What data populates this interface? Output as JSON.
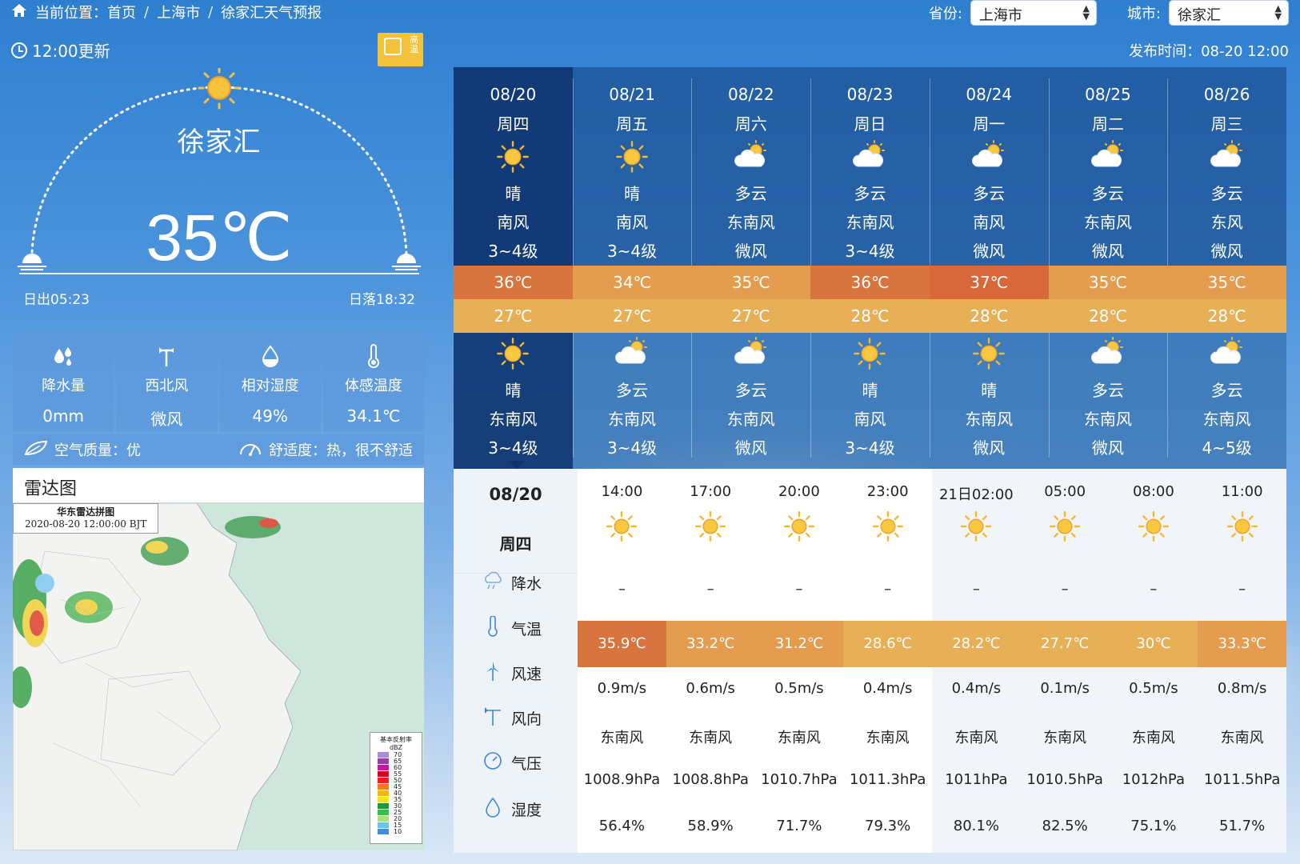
{
  "breadcrumb": {
    "label": "当前位置：",
    "home": "首页",
    "city": "上海市",
    "current": "徐家汇天气预报",
    "sep": "/"
  },
  "province": {
    "label": "省份:",
    "value": "上海市"
  },
  "city": {
    "label": "城市:",
    "value": "徐家汇"
  },
  "current": {
    "update": "12:00更新",
    "alert_badge": "高温",
    "place": "徐家汇",
    "temp": "35℃",
    "sunrise": "日出05:23",
    "sunset": "日落18:32",
    "stats": [
      {
        "icon": "raindrops-icon",
        "label": "降水量",
        "value": "0mm"
      },
      {
        "icon": "wind-vane-icon",
        "label": "西北风",
        "value": "微风"
      },
      {
        "icon": "humidity-drop-icon",
        "label": "相对湿度",
        "value": "49%"
      },
      {
        "icon": "thermometer-icon",
        "label": "体感温度",
        "value": "34.1℃"
      }
    ],
    "air_quality": "空气质量：优",
    "comfort": "舒适度：热，很不舒适"
  },
  "radar": {
    "title": "雷达图",
    "caption_title": "华东雷达拼图",
    "caption_time": "2020-08-20 12:00:00 BJT",
    "legend_title": "基本反射率",
    "legend_unit": "dBZ",
    "legend_values": [
      "70",
      "65",
      "60",
      "55",
      "50",
      "45",
      "40",
      "35",
      "30",
      "25",
      "20",
      "15",
      "10"
    ]
  },
  "publish_time": "发布时间：08-20 12:00",
  "daily": [
    {
      "date": "08/20",
      "weekday": "周四",
      "day_icon": "sun-icon",
      "day_wx": "晴",
      "day_wind": "南风",
      "day_level": "3~4级",
      "high": "36℃",
      "low": "27℃",
      "night_icon": "sun-icon",
      "night_wx": "晴",
      "night_wind": "东南风",
      "night_level": "3~4级",
      "high_color": "#d8743d",
      "low_color": "#e8b056"
    },
    {
      "date": "08/21",
      "weekday": "周五",
      "day_icon": "sun-icon",
      "day_wx": "晴",
      "day_wind": "南风",
      "day_level": "3~4级",
      "high": "34℃",
      "low": "27℃",
      "night_icon": "cloud-sun-icon",
      "night_wx": "多云",
      "night_wind": "东南风",
      "night_level": "3~4级",
      "high_color": "#e49c4e",
      "low_color": "#e8b056"
    },
    {
      "date": "08/22",
      "weekday": "周六",
      "day_icon": "cloud-sun-icon",
      "day_wx": "多云",
      "day_wind": "东南风",
      "day_level": "微风",
      "high": "35℃",
      "low": "27℃",
      "night_icon": "cloud-sun-icon",
      "night_wx": "多云",
      "night_wind": "东南风",
      "night_level": "微风",
      "high_color": "#e49c4e",
      "low_color": "#e8b056"
    },
    {
      "date": "08/23",
      "weekday": "周日",
      "day_icon": "cloud-sun-icon",
      "day_wx": "多云",
      "day_wind": "东南风",
      "day_level": "3~4级",
      "high": "36℃",
      "low": "28℃",
      "night_icon": "sun-icon",
      "night_wx": "晴",
      "night_wind": "南风",
      "night_level": "3~4级",
      "high_color": "#d8743d",
      "low_color": "#e8b056"
    },
    {
      "date": "08/24",
      "weekday": "周一",
      "day_icon": "cloud-sun-icon",
      "day_wx": "多云",
      "day_wind": "南风",
      "day_level": "微风",
      "high": "37℃",
      "low": "28℃",
      "night_icon": "sun-icon",
      "night_wx": "晴",
      "night_wind": "东南风",
      "night_level": "微风",
      "high_color": "#d8673a",
      "low_color": "#e8b056"
    },
    {
      "date": "08/25",
      "weekday": "周二",
      "day_icon": "cloud-sun-icon",
      "day_wx": "多云",
      "day_wind": "东南风",
      "day_level": "微风",
      "high": "35℃",
      "low": "28℃",
      "night_icon": "cloud-sun-icon",
      "night_wx": "多云",
      "night_wind": "东南风",
      "night_level": "微风",
      "high_color": "#e49c4e",
      "low_color": "#e8b056"
    },
    {
      "date": "08/26",
      "weekday": "周三",
      "day_icon": "cloud-sun-icon",
      "day_wx": "多云",
      "day_wind": "东风",
      "day_level": "微风",
      "high": "35℃",
      "low": "28℃",
      "night_icon": "cloud-sun-icon",
      "night_wx": "多云",
      "night_wind": "东南风",
      "night_level": "4~5级",
      "high_color": "#e49c4e",
      "low_color": "#e8b056"
    }
  ],
  "hourly": {
    "date": "08/20",
    "weekday": "周四",
    "row_labels": {
      "rain": "降水",
      "temp": "气温",
      "wind_speed": "风速",
      "wind_dir": "风向",
      "pressure": "气压",
      "humidity": "湿度"
    },
    "columns": [
      {
        "time": "14:00",
        "icon": "sun-icon",
        "rain": "–",
        "temp": "35.9℃",
        "temp_color": "#d8743d",
        "wind_speed": "0.9m/s",
        "wind_dir": "东南风",
        "pressure": "1008.9hPa",
        "humidity": "56.4%"
      },
      {
        "time": "17:00",
        "icon": "sun-icon",
        "rain": "–",
        "temp": "33.2℃",
        "temp_color": "#e49c4e",
        "wind_speed": "0.6m/s",
        "wind_dir": "东南风",
        "pressure": "1008.8hPa",
        "humidity": "58.9%"
      },
      {
        "time": "20:00",
        "icon": "sun-icon",
        "rain": "–",
        "temp": "31.2℃",
        "temp_color": "#e49c4e",
        "wind_speed": "0.5m/s",
        "wind_dir": "东南风",
        "pressure": "1010.7hPa",
        "humidity": "71.7%"
      },
      {
        "time": "23:00",
        "icon": "sun-icon",
        "rain": "–",
        "temp": "28.6℃",
        "temp_color": "#e8b056",
        "wind_speed": "0.4m/s",
        "wind_dir": "东南风",
        "pressure": "1011.3hPa",
        "humidity": "79.3%"
      },
      {
        "time": "21日02:00",
        "icon": "sun-icon",
        "rain": "–",
        "temp": "28.2℃",
        "temp_color": "#e8b056",
        "wind_speed": "0.4m/s",
        "wind_dir": "东南风",
        "pressure": "1011hPa",
        "humidity": "80.1%"
      },
      {
        "time": "05:00",
        "icon": "sun-icon",
        "rain": "–",
        "temp": "27.7℃",
        "temp_color": "#e8b056",
        "wind_speed": "0.1m/s",
        "wind_dir": "东南风",
        "pressure": "1010.5hPa",
        "humidity": "82.5%"
      },
      {
        "time": "08:00",
        "icon": "sun-icon",
        "rain": "–",
        "temp": "30℃",
        "temp_color": "#e8b056",
        "wind_speed": "0.5m/s",
        "wind_dir": "东南风",
        "pressure": "1012hPa",
        "humidity": "75.1%"
      },
      {
        "time": "11:00",
        "icon": "sun-icon",
        "rain": "–",
        "temp": "33.3℃",
        "temp_color": "#e49c4e",
        "wind_speed": "0.8m/s",
        "wind_dir": "东南风",
        "pressure": "1011.5hPa",
        "humidity": "51.7%"
      }
    ]
  }
}
